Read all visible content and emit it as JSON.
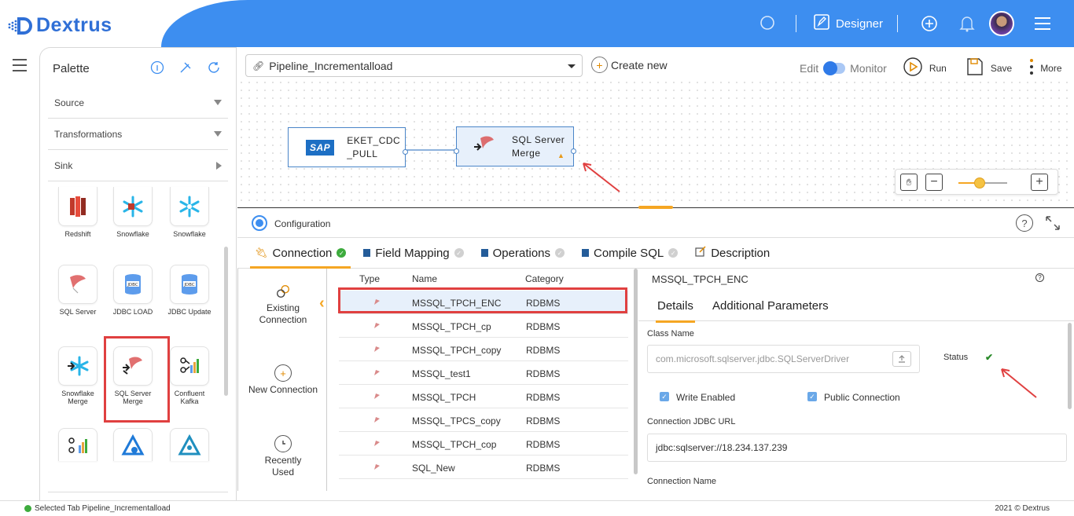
{
  "app": {
    "name": "Dextrus"
  },
  "header": {
    "designer_label": "Designer"
  },
  "palette": {
    "title": "Palette",
    "sections": [
      {
        "label": "Source"
      },
      {
        "label": "Transformations"
      },
      {
        "label": "Sink"
      }
    ],
    "items": [
      {
        "label": "Redshift"
      },
      {
        "label": "Snowflake"
      },
      {
        "label": "Snowflake"
      },
      {
        "label": "SQL Server"
      },
      {
        "label": "JDBC LOAD"
      },
      {
        "label": "JDBC Update"
      },
      {
        "label": "Snowflake Merge"
      },
      {
        "label": "SQL Server Merge"
      },
      {
        "label": "Confluent Kafka"
      }
    ]
  },
  "pipeline": {
    "selected": "Pipeline_Incrementalload",
    "create_new": "Create new",
    "edit_label": "Edit",
    "monitor_label": "Monitor",
    "run_label": "Run",
    "save_label": "Save",
    "more_label": "More"
  },
  "canvas": {
    "nodes": [
      {
        "badge": "SAP",
        "label_line1": "EKET_CDC",
        "label_line2": "_PULL"
      },
      {
        "label_line1": "SQL Server",
        "label_line2": "Merge",
        "warning": "!"
      }
    ]
  },
  "config": {
    "title": "Configuration",
    "help": "?",
    "tabs": [
      {
        "label": "Connection"
      },
      {
        "label": "Field Mapping"
      },
      {
        "label": "Operations"
      },
      {
        "label": "Compile SQL"
      },
      {
        "label": "Description"
      }
    ]
  },
  "connection_side": [
    {
      "label": "Existing Connection"
    },
    {
      "label": "New Connection"
    },
    {
      "label": "Recently Used"
    }
  ],
  "connection_table": {
    "headers": {
      "type": "Type",
      "name": "Name",
      "category": "Category"
    },
    "rows": [
      {
        "name": "MSSQL_TPCH_ENC",
        "category": "RDBMS"
      },
      {
        "name": "MSSQL_TPCH_cp",
        "category": "RDBMS"
      },
      {
        "name": "MSSQL_TPCH_copy",
        "category": "RDBMS"
      },
      {
        "name": "MSSQL_test1",
        "category": "RDBMS"
      },
      {
        "name": "MSSQL_TPCH",
        "category": "RDBMS"
      },
      {
        "name": "MSSQL_TPCS_copy",
        "category": "RDBMS"
      },
      {
        "name": "MSSQL_TPCH_cop",
        "category": "RDBMS"
      },
      {
        "name": "SQL_New",
        "category": "RDBMS"
      }
    ]
  },
  "details": {
    "title": "MSSQL_TPCH_ENC",
    "help": "?",
    "tabs": [
      {
        "label": "Details"
      },
      {
        "label": "Additional Parameters"
      }
    ],
    "class_name_label": "Class Name",
    "class_name_value": "com.microsoft.sqlserver.jdbc.SQLServerDriver",
    "status_label": "Status",
    "write_enabled_label": "Write Enabled",
    "public_connection_label": "Public Connection",
    "jdbc_url_label": "Connection JDBC URL",
    "jdbc_url_value": "jdbc:sqlserver://18.234.137.239",
    "connection_name_label": "Connection Name"
  },
  "footer": {
    "status": "Selected Tab Pipeline_Incrementalload",
    "copyright": "2021 © Dextrus"
  },
  "colors": {
    "brand_blue": "#3d8ef0",
    "accent_orange": "#f5a623",
    "highlight_red": "#e04040",
    "success_green": "#3dab3d"
  }
}
